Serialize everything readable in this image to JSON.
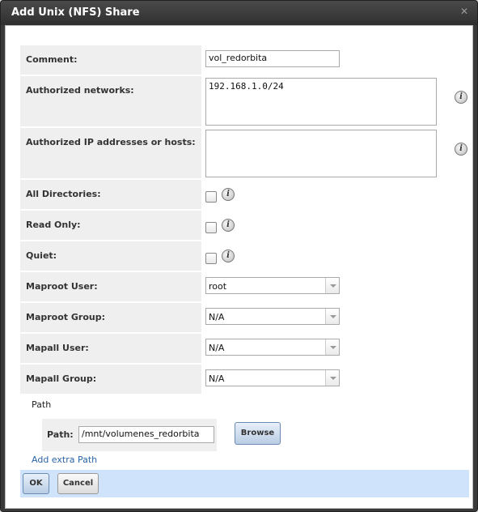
{
  "dialog": {
    "title": "Add Unix (NFS) Share",
    "close_glyph": "✕"
  },
  "form": {
    "comment": {
      "label": "Comment:",
      "value": "vol_redorbita"
    },
    "authorized_networks": {
      "label": "Authorized networks:",
      "value": "192.168.1.0/24"
    },
    "authorized_hosts": {
      "label": "Authorized IP addresses or hosts:",
      "value": ""
    },
    "all_directories": {
      "label": "All Directories:",
      "checked": false
    },
    "read_only": {
      "label": "Read Only:",
      "checked": false
    },
    "quiet": {
      "label": "Quiet:",
      "checked": false
    },
    "maproot_user": {
      "label": "Maproot User:",
      "value": "root"
    },
    "maproot_group": {
      "label": "Maproot Group:",
      "value": "N/A"
    },
    "mapall_user": {
      "label": "Mapall User:",
      "value": "N/A"
    },
    "mapall_group": {
      "label": "Mapall Group:",
      "value": "N/A"
    }
  },
  "path_section": {
    "heading": "Path",
    "label": "Path:",
    "value": "/mnt/volumenes_redorbita",
    "browse_label": "Browse",
    "add_extra_label": "Add extra Path"
  },
  "buttons": {
    "ok_label": "OK",
    "cancel_label": "Cancel"
  },
  "icons": {
    "info": "info-icon",
    "info_glyph": "i"
  }
}
